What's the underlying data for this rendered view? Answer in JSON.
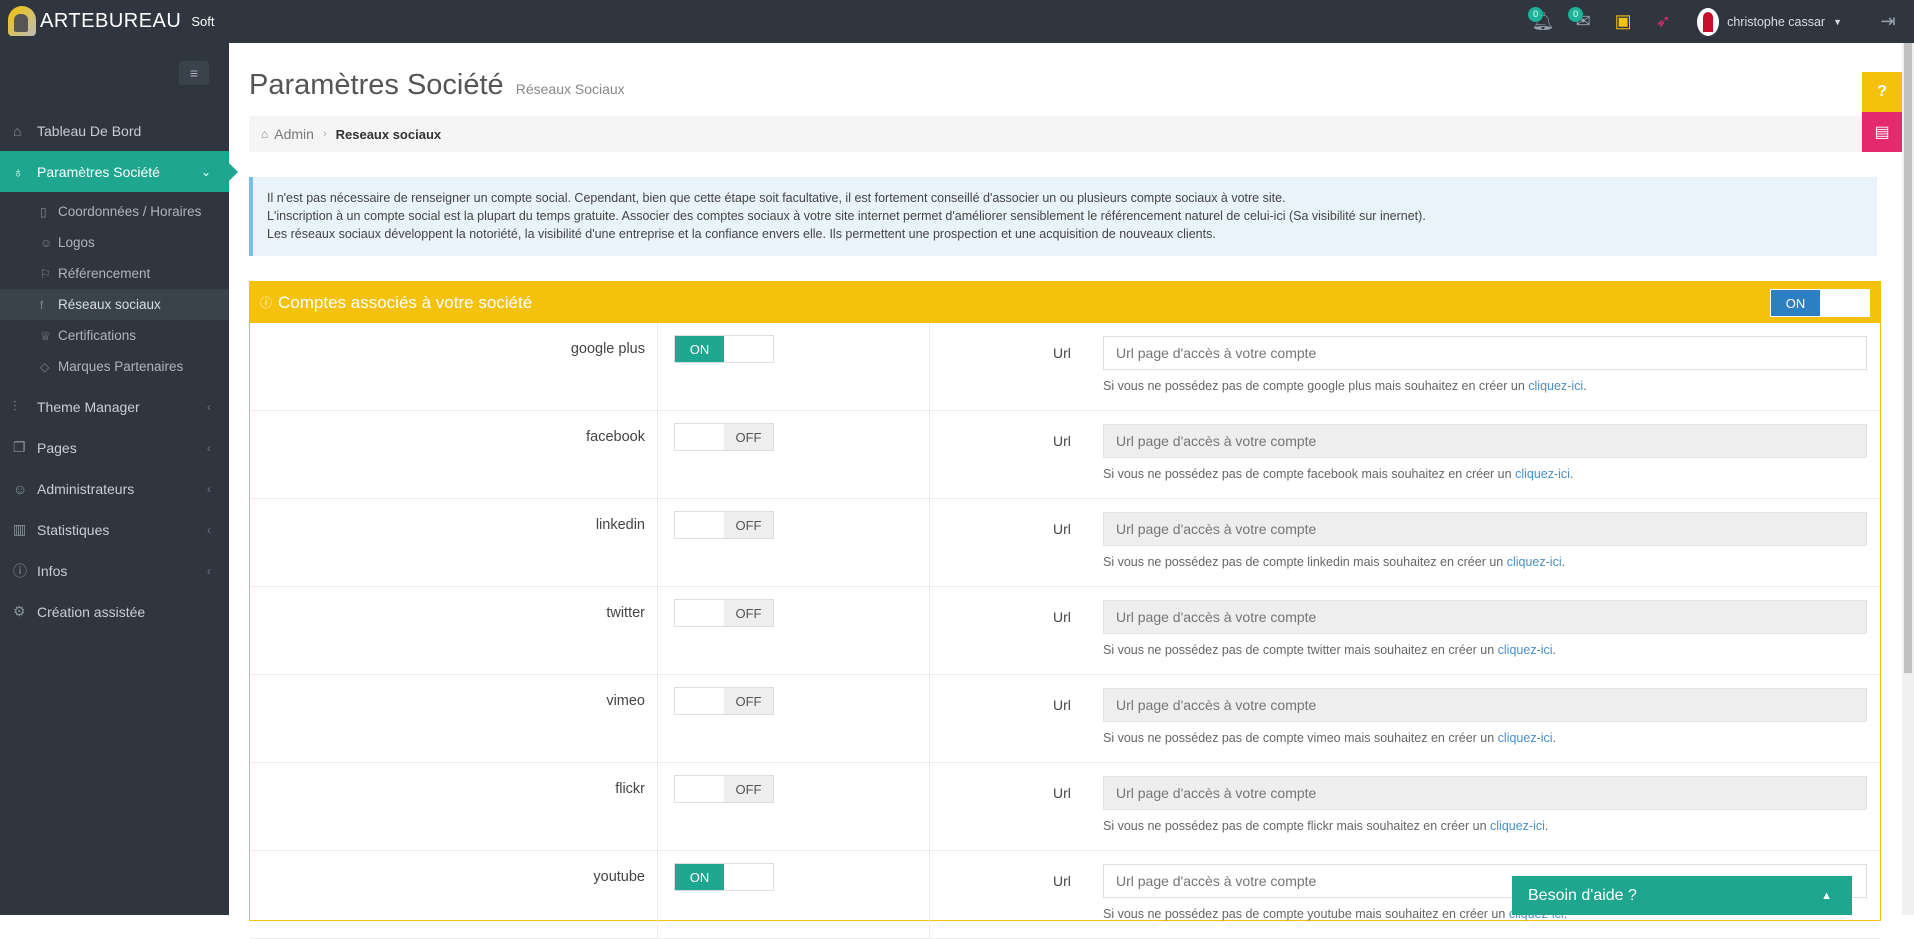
{
  "app": {
    "brand": "ARTEBUREAU",
    "brand_soft": "Soft"
  },
  "topbar": {
    "notifications_count": "0",
    "messages_count": "0",
    "user_name": "christophe cassar"
  },
  "sidebar": {
    "items": [
      {
        "label": "Tableau De Bord"
      },
      {
        "label": "Paramètres Société"
      },
      {
        "label": "Theme Manager"
      },
      {
        "label": "Pages"
      },
      {
        "label": "Administrateurs"
      },
      {
        "label": "Statistiques"
      },
      {
        "label": "Infos"
      },
      {
        "label": "Création assistée"
      }
    ],
    "sub_items": [
      {
        "label": "Coordonnées / Horaires"
      },
      {
        "label": "Logos"
      },
      {
        "label": "Référencement"
      },
      {
        "label": "Réseaux sociaux"
      },
      {
        "label": "Certifications"
      },
      {
        "label": "Marques Partenaires"
      }
    ]
  },
  "page": {
    "title": "Paramètres Société",
    "subtitle": "Réseaux Sociaux"
  },
  "breadcrumb": {
    "home": "Admin",
    "current": "Reseaux sociaux"
  },
  "info": {
    "line1": "Il n'est pas nécessaire de renseigner un compte social. Cependant, bien que cette étape soit facultative, il est fortement conseillé d'associer un ou plusieurs compte sociaux à votre site.",
    "line2": "L'inscription à un compte social est la plupart du temps gratuite. Associer des comptes sociaux à votre site internet permet d'améliorer sensiblement le référencement naturel de celui-ici (Sa visibilité sur inernet).",
    "line3": "Les réseaux sociaux développent la notoriété, la visibilité d'une entreprise et la confiance envers elle. Ils permettent une prospection et une acquisition de nouveaux clients."
  },
  "panel": {
    "title": "Comptes associés à votre société",
    "toggle_on": "ON",
    "url_label": "Url",
    "url_placeholder": "Url page d'accès à votre compte",
    "link_text": "cliquez-ici",
    "rows": [
      {
        "name": "google plus",
        "state": "ON",
        "help": "Si vous ne possédez pas de compte google plus mais souhaitez en créer un "
      },
      {
        "name": "facebook",
        "state": "OFF",
        "help": "Si vous ne possédez pas de compte facebook mais souhaitez en créer un "
      },
      {
        "name": "linkedin",
        "state": "OFF",
        "help": "Si vous ne possédez pas de compte linkedin mais souhaitez en créer un "
      },
      {
        "name": "twitter",
        "state": "OFF",
        "help": "Si vous ne possédez pas de compte twitter mais souhaitez en créer un "
      },
      {
        "name": "vimeo",
        "state": "OFF",
        "help": "Si vous ne possédez pas de compte vimeo mais souhaitez en créer un "
      },
      {
        "name": "flickr",
        "state": "OFF",
        "help": "Si vous ne possédez pas de compte flickr mais souhaitez en créer un "
      },
      {
        "name": "youtube",
        "state": "ON",
        "help": "Si vous ne possédez pas de compte youtube mais souhaitez en créer un "
      }
    ]
  },
  "side_buttons": {
    "question": "?"
  },
  "help_box": {
    "label": "Besoin d'aide ?"
  },
  "colors": {
    "accent": "#1fa68f",
    "yellow": "#f4c20d",
    "pink": "#e42a6c",
    "dark": "#2f3640",
    "blue_toggle": "#2d7fc4"
  }
}
